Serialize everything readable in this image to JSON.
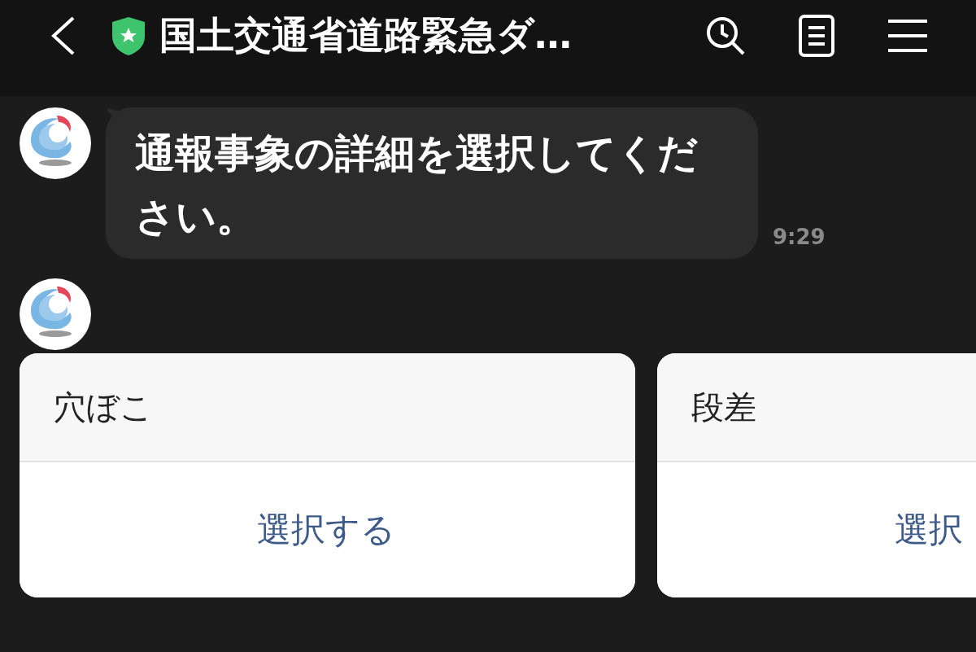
{
  "header": {
    "title": "国土交通省道路緊急ダ…"
  },
  "messages": [
    {
      "kind": "text",
      "text": "通報事象の詳細を選択してください。",
      "time": "9:29"
    },
    {
      "kind": "carousel",
      "cards": [
        {
          "title": "穴ぼこ",
          "action": "選択する"
        },
        {
          "title": "段差",
          "action": "選択"
        }
      ]
    }
  ]
}
